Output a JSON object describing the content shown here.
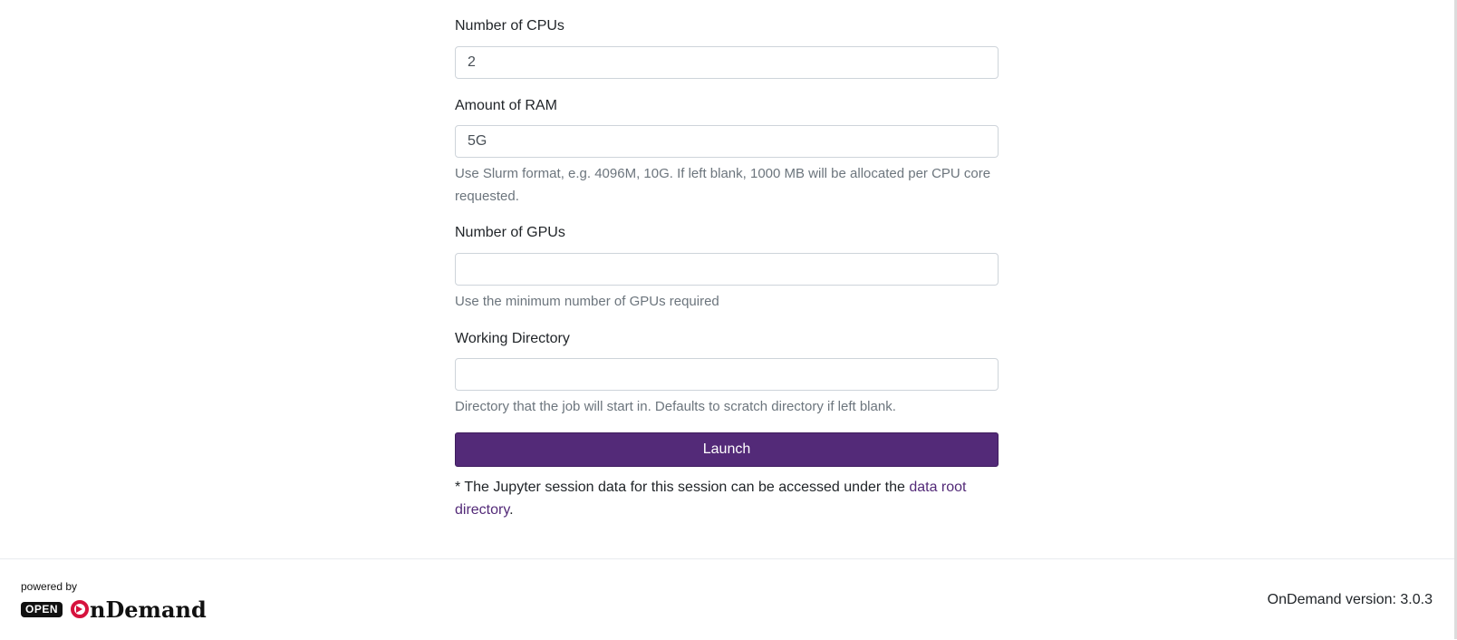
{
  "form": {
    "cpus": {
      "label": "Number of CPUs",
      "value": "2"
    },
    "ram": {
      "label": "Amount of RAM",
      "value": "5G",
      "help": "Use Slurm format, e.g. 4096M, 10G. If left blank, 1000 MB will be allocated per CPU core requested."
    },
    "gpus": {
      "label": "Number of GPUs",
      "value": "",
      "help": "Use the minimum number of GPUs required"
    },
    "workdir": {
      "label": "Working Directory",
      "value": "",
      "help": "Directory that the job will start in. Defaults to scratch directory if left blank."
    },
    "launch_label": "Launch",
    "note_prefix": "* The Jupyter session data for this session can be accessed under the ",
    "note_link": "data root directory",
    "note_suffix": "."
  },
  "footer": {
    "powered_by": "powered by",
    "logo_open": "OPEN",
    "logo_text": "nDemand",
    "version": "OnDemand version: 3.0.3"
  },
  "colors": {
    "accent": "#532a78",
    "logo_red": "#d6123d"
  }
}
